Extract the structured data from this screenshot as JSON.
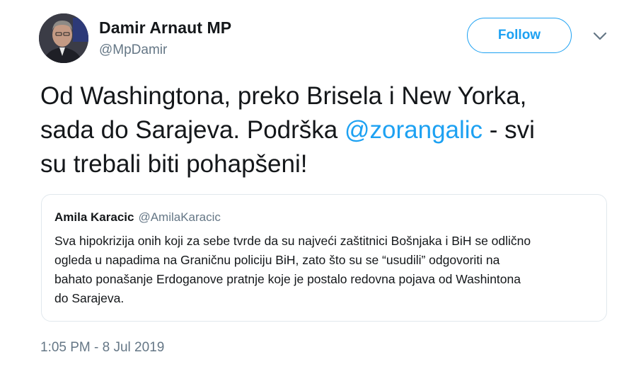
{
  "author": {
    "display_name": "Damir Arnaut MP",
    "handle": "@MpDamir"
  },
  "follow_button": {
    "label": "Follow"
  },
  "tweet": {
    "line1": "Od Washingtona, preko Brisela i New Yorka,",
    "line2_pre": "sada do Sarajeva. Podrška ",
    "mention": "@zorangalic",
    "line2_post": " - svi",
    "line3": "su trebali biti pohapšeni!"
  },
  "quoted_tweet": {
    "name": "Amila Karacic",
    "handle": "@AmilaKaracic",
    "lines": [
      "Sva hipokrizija onih koji za sebe tvrde da su najveći zaštitnici Bošnjaka i BiH se odlično",
      "ogleda u napadima na Graničnu policiju BiH, zato što su se “usudili” odgovoriti na",
      "bahato ponašanje Erdoganove pratnje koje je postalo redovna pojava od Washintona",
      "do Sarajeva."
    ]
  },
  "timestamp": "1:05 PM - 8 Jul 2019",
  "colors": {
    "accent": "#1da1f2",
    "text": "#14171a",
    "secondary": "#657786",
    "border": "#e1e8ed"
  },
  "icons": {
    "avatar": "profile-photo",
    "menu": "chevron-down-icon"
  }
}
